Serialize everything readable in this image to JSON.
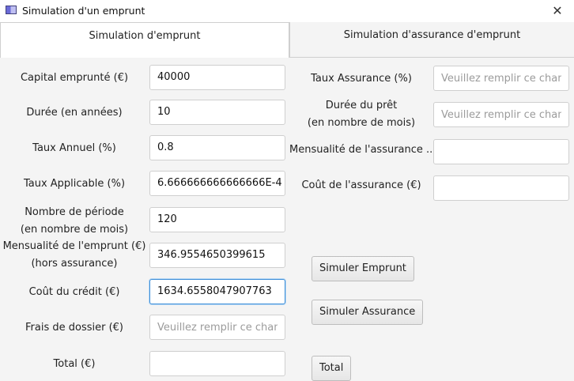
{
  "window": {
    "title": "Simulation d'un emprunt",
    "close_glyph": "✕"
  },
  "tabs": [
    {
      "label": "Simulation d'emprunt",
      "active": true
    },
    {
      "label": "Simulation d'assurance d'emprunt",
      "active": false
    }
  ],
  "loan": {
    "capital": {
      "label": "Capital emprunté (€)",
      "value": "40000"
    },
    "duree": {
      "label": "Durée (en années)",
      "value": "10"
    },
    "taux_annuel": {
      "label": "Taux Annuel (%)",
      "value": "0.8"
    },
    "taux_applicable": {
      "label": "Taux Applicable (%)",
      "value": "6.666666666666666E-4"
    },
    "nombre_periode": {
      "label_line1": "Nombre de période",
      "label_line2": "(en nombre de mois)",
      "value": "120"
    },
    "mensualite": {
      "label_line1": "Mensualité de l'emprunt (€)",
      "label_line2": "(hors assurance)",
      "value": "346.9554650399615"
    },
    "cout_credit": {
      "label": "Coût du crédit (€)",
      "value": "1634.6558047907763"
    },
    "frais_dossier": {
      "label": "Frais de dossier (€)",
      "value": "",
      "placeholder": "Veuillez remplir ce chan"
    },
    "total": {
      "label": "Total (€)",
      "value": ""
    }
  },
  "insurance": {
    "taux_assurance": {
      "label": "Taux Assurance (%)",
      "value": "",
      "placeholder": "Veuillez remplir ce chan"
    },
    "duree_pret": {
      "label_line1": "Durée du prêt",
      "label_line2": "(en nombre de mois)",
      "value": "",
      "placeholder": "Veuillez remplir ce chan"
    },
    "mensualite_assurance": {
      "label": "Mensualité de l'assurance ...",
      "value": ""
    },
    "cout_assurance": {
      "label": "Coût de l'assurance (€)",
      "value": ""
    }
  },
  "buttons": {
    "simuler_emprunt": "Simuler Emprunt",
    "simuler_assurance": "Simuler Assurance",
    "total": "Total"
  }
}
